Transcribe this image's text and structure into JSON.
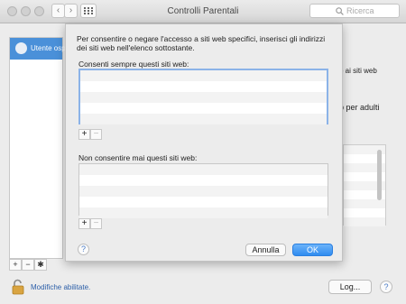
{
  "window": {
    "title": "Controlli Parentali",
    "search_placeholder": "Ricerca"
  },
  "sidebar": {
    "selected_user": "Utente osp"
  },
  "background": {
    "partial_text_1": "o ai siti web",
    "partial_text_2": "b per adulti"
  },
  "sheet": {
    "intro": "Per consentire o negare l'accesso a siti web specifici, inserisci gli indirizzi dei siti web nell'elenco sottostante.",
    "allow_label": "Consenti sempre questi siti web:",
    "deny_label": "Non consentire mai questi siti web:",
    "add_symbol": "+",
    "remove_symbol": "−",
    "help_symbol": "?",
    "cancel_label": "Annulla",
    "ok_label": "OK"
  },
  "footer": {
    "status": "Modifiche abilitate.",
    "log_label": "Log...",
    "help_symbol": "?"
  },
  "colors": {
    "accent": "#2f8cf0",
    "selection": "#4a90d9",
    "focus_ring": "#8bb3e8"
  },
  "icons": [
    "back-arrow-icon",
    "forward-arrow-icon",
    "grid-icon",
    "search-icon",
    "user-avatar-icon",
    "gear-icon",
    "lock-open-icon",
    "help-icon"
  ]
}
